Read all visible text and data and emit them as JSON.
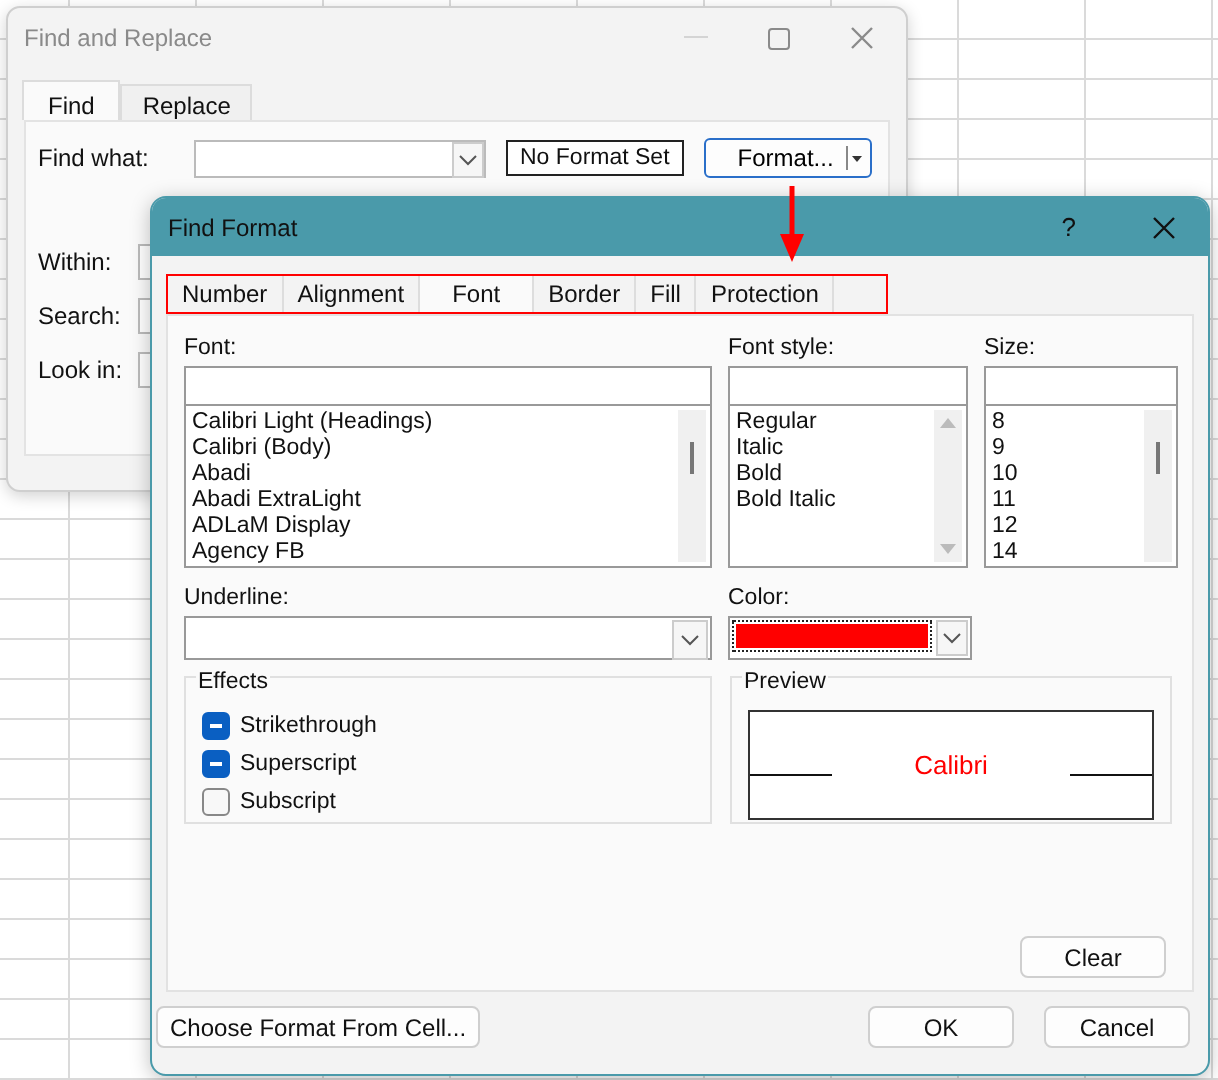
{
  "back_window": {
    "title": "Find and Replace",
    "tabs": [
      {
        "label": "Find",
        "selected": true
      },
      {
        "label": "Replace",
        "selected": false
      }
    ],
    "find_what": {
      "label": "Find what:"
    },
    "format_status": "No Format Set",
    "format_button": "Format...",
    "options": [
      {
        "label": "Within:"
      },
      {
        "label": "Search:"
      },
      {
        "label": "Look in:"
      }
    ]
  },
  "dialog": {
    "title": "Find Format",
    "help": "?",
    "tabs": [
      {
        "label": "Number",
        "selected": false
      },
      {
        "label": "Alignment",
        "selected": false
      },
      {
        "label": "Font",
        "selected": true
      },
      {
        "label": "Border",
        "selected": false
      },
      {
        "label": "Fill",
        "selected": false
      },
      {
        "label": "Protection",
        "selected": false
      }
    ],
    "font": {
      "label": "Font:",
      "items": [
        "Calibri Light (Headings)",
        "Calibri (Body)",
        "Abadi",
        "Abadi ExtraLight",
        "ADLaM Display",
        "Agency FB"
      ]
    },
    "font_style": {
      "label": "Font style:",
      "items": [
        "Regular",
        "Italic",
        "Bold",
        "Bold Italic"
      ]
    },
    "size": {
      "label": "Size:",
      "items": [
        "8",
        "9",
        "10",
        "11",
        "12",
        "14"
      ]
    },
    "underline": {
      "label": "Underline:"
    },
    "color": {
      "label": "Color:",
      "color": "#ff0000"
    },
    "effects": {
      "title": "Effects",
      "items": [
        {
          "label": "Strikethrough",
          "indeterminate": true
        },
        {
          "label": "Superscript",
          "indeterminate": true
        },
        {
          "label": "Subscript",
          "indeterminate": false
        }
      ]
    },
    "preview": {
      "title": "Preview",
      "sample": "Calibri"
    },
    "clear_button": "Clear",
    "choose_button": "Choose Format From Cell...",
    "ok_button": "OK",
    "cancel_button": "Cancel"
  }
}
